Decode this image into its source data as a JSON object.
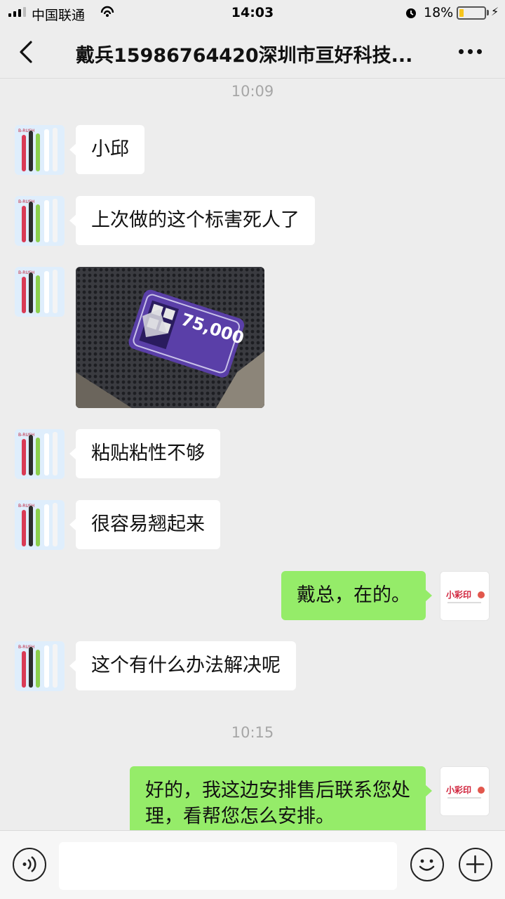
{
  "status_bar": {
    "carrier": "中国联通",
    "time": "14:03",
    "battery": "18%",
    "battery_level": 0.18,
    "battery_color": "#f7c51b"
  },
  "nav": {
    "title": "戴兵15986764420深圳市亘好科技...",
    "back_icon": "chevron-left-icon",
    "more_icon": "more-dots-icon"
  },
  "messages": {
    "time1": "10:09",
    "m1": "小邱",
    "m2": "上次做的这个标害死人了",
    "m3_image_text": "75,000",
    "m4": "粘贴粘性不够",
    "m5": "很容易翘起来",
    "m6": "戴总，在的。",
    "m7": "这个有什么办法解决呢",
    "time2": "10:15",
    "m8_line1": "好的，我这边安排售后联系您处",
    "m8_line2": "理，看帮您怎么安排。"
  },
  "avatars": {
    "contact_brand": "B-RUSH",
    "self_brand": "小彩印"
  },
  "input_bar": {
    "voice_icon": "voice-icon",
    "emoji_icon": "emoji-icon",
    "plus_icon": "plus-icon"
  },
  "colors": {
    "background": "#ededed",
    "bubble_out": "#95ec69",
    "bubble_in": "#ffffff",
    "timestamp": "#a6a6a6"
  }
}
